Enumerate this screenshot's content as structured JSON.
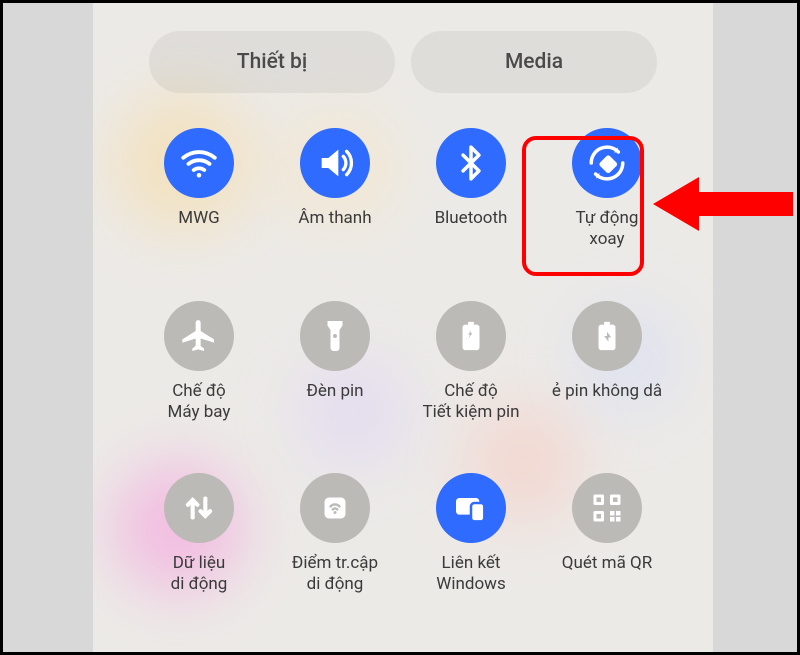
{
  "tabs": {
    "devices": "Thiết bị",
    "media": "Media"
  },
  "tiles": {
    "wifi": {
      "label": "MWG"
    },
    "sound": {
      "label": "Âm thanh"
    },
    "bluetooth": {
      "label": "Bluetooth"
    },
    "rotate": {
      "label": "Tự động\nxoay"
    },
    "airplane": {
      "label": "Chế độ\nMáy bay"
    },
    "flash": {
      "label": "Đèn pin"
    },
    "battery": {
      "label": "Chế độ\nTiết kiệm pin"
    },
    "share": {
      "label": "ẻ pin không dâ"
    },
    "data": {
      "label": "Dữ liệu\ndi động"
    },
    "hotspot": {
      "label": "Điểm tr.cập\ndi động"
    },
    "link": {
      "label": "Liên kết\nWindows"
    },
    "qr": {
      "label": "Quét mã QR"
    }
  },
  "colors": {
    "on": "#2f6bff",
    "off": "#bcbab6",
    "highlight": "#ff0000"
  }
}
